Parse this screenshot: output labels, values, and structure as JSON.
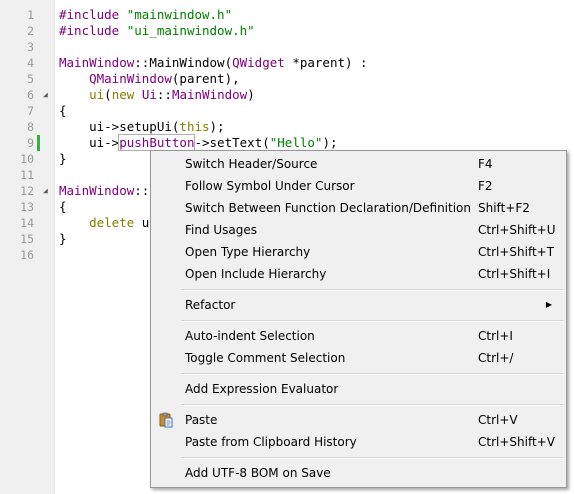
{
  "editor": {
    "line_numbers": [
      "1",
      "2",
      "3",
      "4",
      "5",
      "6",
      "7",
      "8",
      "9",
      "10",
      "11",
      "12",
      "13",
      "14",
      "15",
      "16"
    ],
    "lines": {
      "l1": [
        {
          "t": "#include ",
          "c": "typ"
        },
        {
          "t": "\"mainwindow.h\"",
          "c": "str"
        }
      ],
      "l2": [
        {
          "t": "#include ",
          "c": "typ"
        },
        {
          "t": "\"ui_mainwindow.h\"",
          "c": "str"
        }
      ],
      "l3": [],
      "l4": [
        {
          "t": "MainWindow",
          "c": "typ"
        },
        {
          "t": "::MainWindow(",
          "c": ""
        },
        {
          "t": "QWidget",
          "c": "typ"
        },
        {
          "t": " *parent) :",
          "c": ""
        }
      ],
      "l5": [
        {
          "t": "    ",
          "c": ""
        },
        {
          "t": "QMainWindow",
          "c": "typ"
        },
        {
          "t": "(parent),",
          "c": ""
        }
      ],
      "l6": [
        {
          "t": "    ",
          "c": ""
        },
        {
          "t": "ui",
          "c": "kw"
        },
        {
          "t": "(",
          "c": ""
        },
        {
          "t": "new",
          "c": "kw"
        },
        {
          "t": " ",
          "c": ""
        },
        {
          "t": "Ui",
          "c": "typ"
        },
        {
          "t": "::",
          "c": ""
        },
        {
          "t": "MainWindow",
          "c": "typ"
        },
        {
          "t": ")",
          "c": ""
        }
      ],
      "l7": [
        {
          "t": "{",
          "c": ""
        }
      ],
      "l8": [
        {
          "t": "    ui->setupUi(",
          "c": ""
        },
        {
          "t": "this",
          "c": "kw"
        },
        {
          "t": ");",
          "c": ""
        }
      ],
      "l9": [
        {
          "t": "    ui->",
          "c": ""
        },
        {
          "t": "pushButton",
          "c": "typ hl"
        },
        {
          "t": "->setText(",
          "c": ""
        },
        {
          "t": "\"Hello\"",
          "c": "str"
        },
        {
          "t": ");",
          "c": ""
        }
      ],
      "l10": [
        {
          "t": "}",
          "c": ""
        }
      ],
      "l11": [],
      "l12": [
        {
          "t": "MainWindow",
          "c": "typ"
        },
        {
          "t": "::",
          "c": ""
        }
      ],
      "l13": [
        {
          "t": "{",
          "c": ""
        }
      ],
      "l14": [
        {
          "t": "    ",
          "c": ""
        },
        {
          "t": "delete",
          "c": "kw"
        },
        {
          "t": " u",
          "c": ""
        }
      ],
      "l15": [
        {
          "t": "}",
          "c": ""
        }
      ],
      "l16": []
    }
  },
  "context_menu": {
    "items": [
      {
        "label": "Switch Header/Source",
        "shortcut": "F4"
      },
      {
        "label": "Follow Symbol Under Cursor",
        "shortcut": "F2"
      },
      {
        "label": "Switch Between Function Declaration/Definition",
        "shortcut": "Shift+F2"
      },
      {
        "label": "Find Usages",
        "shortcut": "Ctrl+Shift+U"
      },
      {
        "label": "Open Type Hierarchy",
        "shortcut": "Ctrl+Shift+T"
      },
      {
        "label": "Open Include Hierarchy",
        "shortcut": "Ctrl+Shift+I"
      },
      {
        "label": "Refactor",
        "shortcut": ""
      },
      {
        "label": "Auto-indent Selection",
        "shortcut": "Ctrl+I"
      },
      {
        "label": "Toggle Comment Selection",
        "shortcut": "Ctrl+/"
      },
      {
        "label": "Add Expression Evaluator",
        "shortcut": ""
      },
      {
        "label": "Paste",
        "shortcut": "Ctrl+V",
        "icon": "paste-icon"
      },
      {
        "label": "Paste from Clipboard History",
        "shortcut": "Ctrl+Shift+V"
      },
      {
        "label": "Add UTF-8 BOM on Save",
        "shortcut": ""
      }
    ],
    "submenu_arrow_icon": "submenu-arrow-icon"
  },
  "colors": {
    "keyword": "#808000",
    "type": "#800080",
    "string": "#008000",
    "gutter_bg": "#f0f0f0",
    "menu_bg": "#f0f0f0",
    "modified_marker": "#38b138"
  }
}
